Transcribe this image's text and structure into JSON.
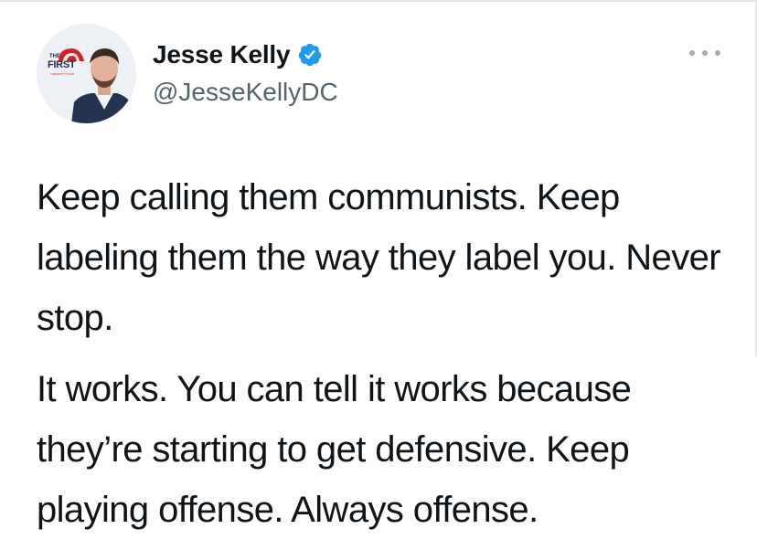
{
  "tweet": {
    "author": {
      "display_name": "Jesse Kelly",
      "handle": "@JesseKellyDC",
      "verified": true,
      "avatar_logo": {
        "small_text": "THE",
        "brand": "FIRST",
        "url_text": "THEFIRSTTV.COM",
        "brand_color": "#d61f26"
      }
    },
    "body": {
      "paragraph_1": "Keep calling them communists. Keep labeling them the way they label you. Never stop.",
      "paragraph_2": "It works. You can tell it works because they’re starting to get defensive. Keep playing offense. Always offense."
    },
    "icons": {
      "verified": "verified-badge-icon",
      "more": "more-options-icon"
    },
    "colors": {
      "text": "#0f1419",
      "muted": "#536471",
      "verified_blue": "#1d9bf0"
    }
  }
}
